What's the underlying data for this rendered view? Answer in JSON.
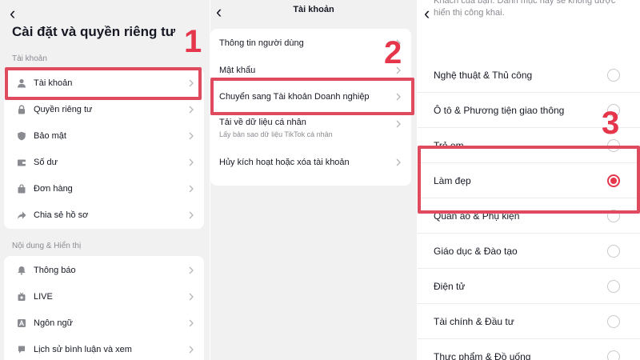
{
  "panel1": {
    "title": "Cài đặt và quyền riêng tư",
    "section_account": "Tài khoản",
    "account_items": [
      {
        "label": "Tài khoản",
        "icon": "person-icon"
      },
      {
        "label": "Quyền riêng tư",
        "icon": "lock-icon"
      },
      {
        "label": "Bảo mật",
        "icon": "shield-icon"
      },
      {
        "label": "Số dư",
        "icon": "wallet-icon"
      },
      {
        "label": "Đơn hàng",
        "icon": "bag-icon"
      },
      {
        "label": "Chia sẻ hồ sơ",
        "icon": "share-icon"
      }
    ],
    "section_content": "Nội dung & Hiển thị",
    "content_items": [
      {
        "label": "Thông báo",
        "icon": "bell-icon"
      },
      {
        "label": "LIVE",
        "icon": "live-icon"
      },
      {
        "label": "Ngôn ngữ",
        "icon": "language-icon"
      },
      {
        "label": "Lịch sử bình luận và xem",
        "icon": "history-icon"
      }
    ],
    "step": "1"
  },
  "panel2": {
    "title": "Tài khoản",
    "items": [
      {
        "label": "Thông tin người dùng"
      },
      {
        "label": "Mật khẩu"
      },
      {
        "label": "Chuyển sang Tài khoản Doanh nghiệp"
      },
      {
        "label": "Tải về dữ liệu cá nhân",
        "sub": "Lấy bản sao dữ liệu TikTok cá nhân"
      },
      {
        "label": "Hủy kích hoạt hoặc xóa tài khoản"
      }
    ],
    "step": "2"
  },
  "panel3": {
    "header_text": "Khách của bạn. Danh mục này sẽ không được hiển thị công khai.",
    "categories": [
      {
        "label": "Nghệ thuật & Thủ công",
        "selected": false
      },
      {
        "label": "Ô tô & Phương tiện giao thông",
        "selected": false
      },
      {
        "label": "Trẻ em",
        "selected": false
      },
      {
        "label": "Làm đẹp",
        "selected": true
      },
      {
        "label": "Quần áo & Phụ kiện",
        "selected": false
      },
      {
        "label": "Giáo dục & Đào tạo",
        "selected": false
      },
      {
        "label": "Điện tử",
        "selected": false
      },
      {
        "label": "Tài chính & Đầu tư",
        "selected": false
      },
      {
        "label": "Thực phẩm & Đồ uống",
        "selected": false
      }
    ],
    "step": "3"
  },
  "colors": {
    "accent": "#e5364b",
    "highlight_border": "#e04a5e"
  }
}
